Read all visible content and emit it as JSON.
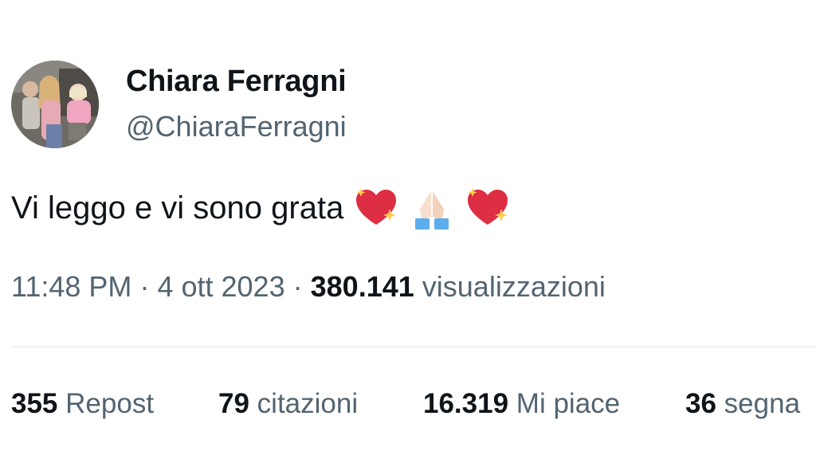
{
  "author": {
    "display_name": "Chiara Ferragni",
    "handle": "@ChiaraFerragni"
  },
  "tweet": {
    "text": "Vi leggo e vi sono grata",
    "emojis": [
      "sparkling-heart-icon",
      "folded-hands-icon",
      "sparkling-heart-icon"
    ]
  },
  "meta": {
    "time": "11:48 PM",
    "separator": "·",
    "date": "4 ott 2023",
    "views_count": "380.141",
    "views_label": "visualizzazioni"
  },
  "stats": [
    {
      "count": "355",
      "label": "Repost"
    },
    {
      "count": "79",
      "label": "citazioni"
    },
    {
      "count": "16.319",
      "label": "Mi piace"
    },
    {
      "count": "36",
      "label": "segna"
    }
  ],
  "colors": {
    "text_primary": "#0f1419",
    "text_secondary": "#536471",
    "divider": "#eff3f4"
  }
}
